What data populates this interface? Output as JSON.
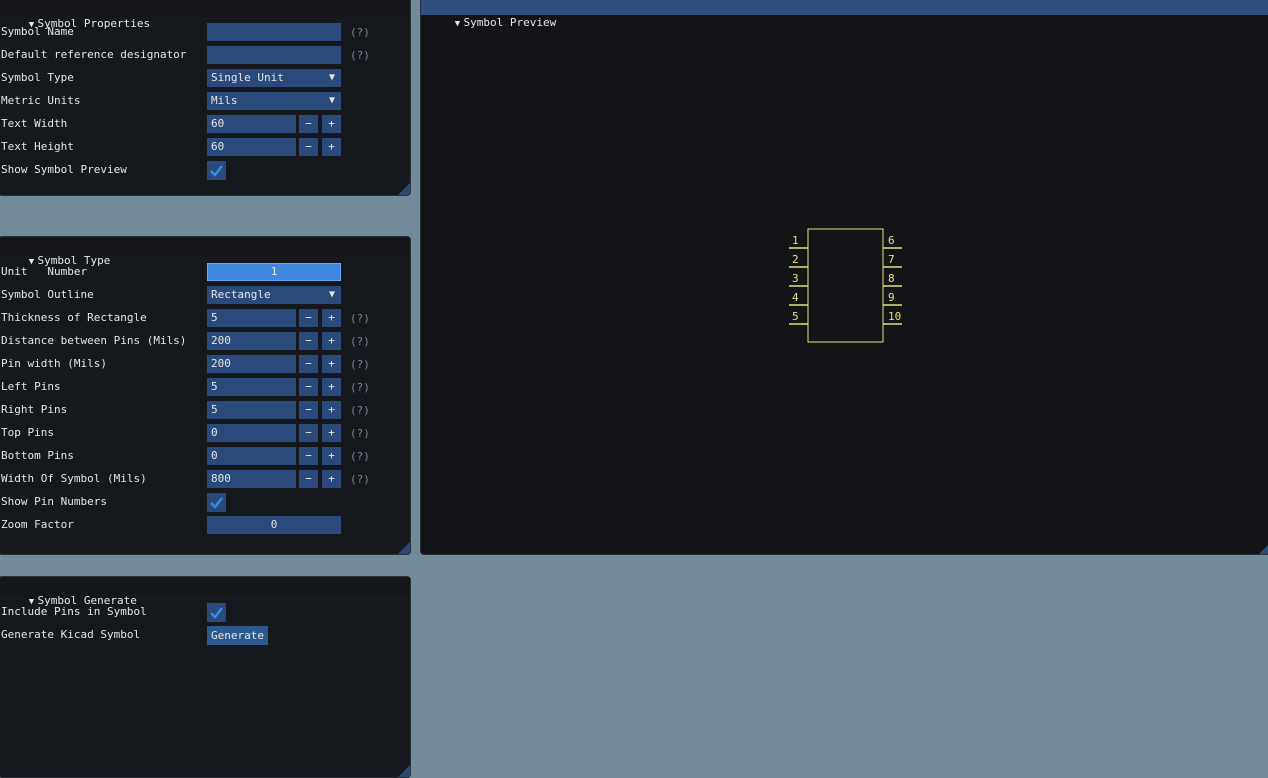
{
  "symbol_properties": {
    "title": "Symbol Properties",
    "rows": {
      "symbol_name": {
        "label": "Symbol Name",
        "value": "",
        "help": "(?)"
      },
      "default_ref": {
        "label": "Default reference designator",
        "value": "",
        "help": "(?)"
      },
      "symbol_type": {
        "label": "Symbol Type",
        "value": "Single Unit"
      },
      "metric_units": {
        "label": "Metric Units",
        "value": "Mils"
      },
      "text_width": {
        "label": "Text Width",
        "value": "60"
      },
      "text_height": {
        "label": "Text Height",
        "value": "60"
      },
      "show_preview": {
        "label": "Show Symbol Preview",
        "checked": true
      }
    }
  },
  "symbol_type_panel": {
    "title": "Symbol Type",
    "unit_number": {
      "label": "Unit   Number",
      "value": "1"
    },
    "symbol_outline": {
      "label": "Symbol Outline",
      "value": "Rectangle"
    },
    "thickness": {
      "label": "Thickness of Rectangle",
      "value": "5",
      "help": "(?)"
    },
    "pin_distance": {
      "label": "Distance between Pins (Mils)",
      "value": "200",
      "help": "(?)"
    },
    "pin_width": {
      "label": "Pin width (Mils)",
      "value": "200",
      "help": "(?)"
    },
    "left_pins": {
      "label": "Left Pins",
      "value": "5",
      "help": "(?)"
    },
    "right_pins": {
      "label": "Right Pins",
      "value": "5",
      "help": "(?)"
    },
    "top_pins": {
      "label": "Top Pins",
      "value": "0",
      "help": "(?)"
    },
    "bottom_pins": {
      "label": "Bottom Pins",
      "value": "0",
      "help": "(?)"
    },
    "symbol_width": {
      "label": "Width Of Symbol (Mils)",
      "value": "800",
      "help": "(?)"
    },
    "show_pin_numbers": {
      "label": "Show Pin Numbers",
      "checked": true
    },
    "zoom_factor": {
      "label": "Zoom Factor",
      "value": "0"
    }
  },
  "symbol_generate": {
    "title": "Symbol Generate",
    "include_pins": {
      "label": "Include Pins in Symbol",
      "checked": true
    },
    "generate": {
      "label": "Generate Kicad Symbol",
      "button": "Generate"
    }
  },
  "preview": {
    "title": "Symbol Preview",
    "left_pin_numbers": [
      "1",
      "2",
      "3",
      "4",
      "5"
    ],
    "right_pin_numbers": [
      "6",
      "7",
      "8",
      "9",
      "10"
    ],
    "stroke_color": "#e6e27a"
  },
  "buttons": {
    "minus": "−",
    "plus": "+"
  },
  "colors": {
    "background": "#728a99",
    "panel": "#15181d",
    "frame": "#294a7a",
    "accent": "#3f87e0"
  }
}
